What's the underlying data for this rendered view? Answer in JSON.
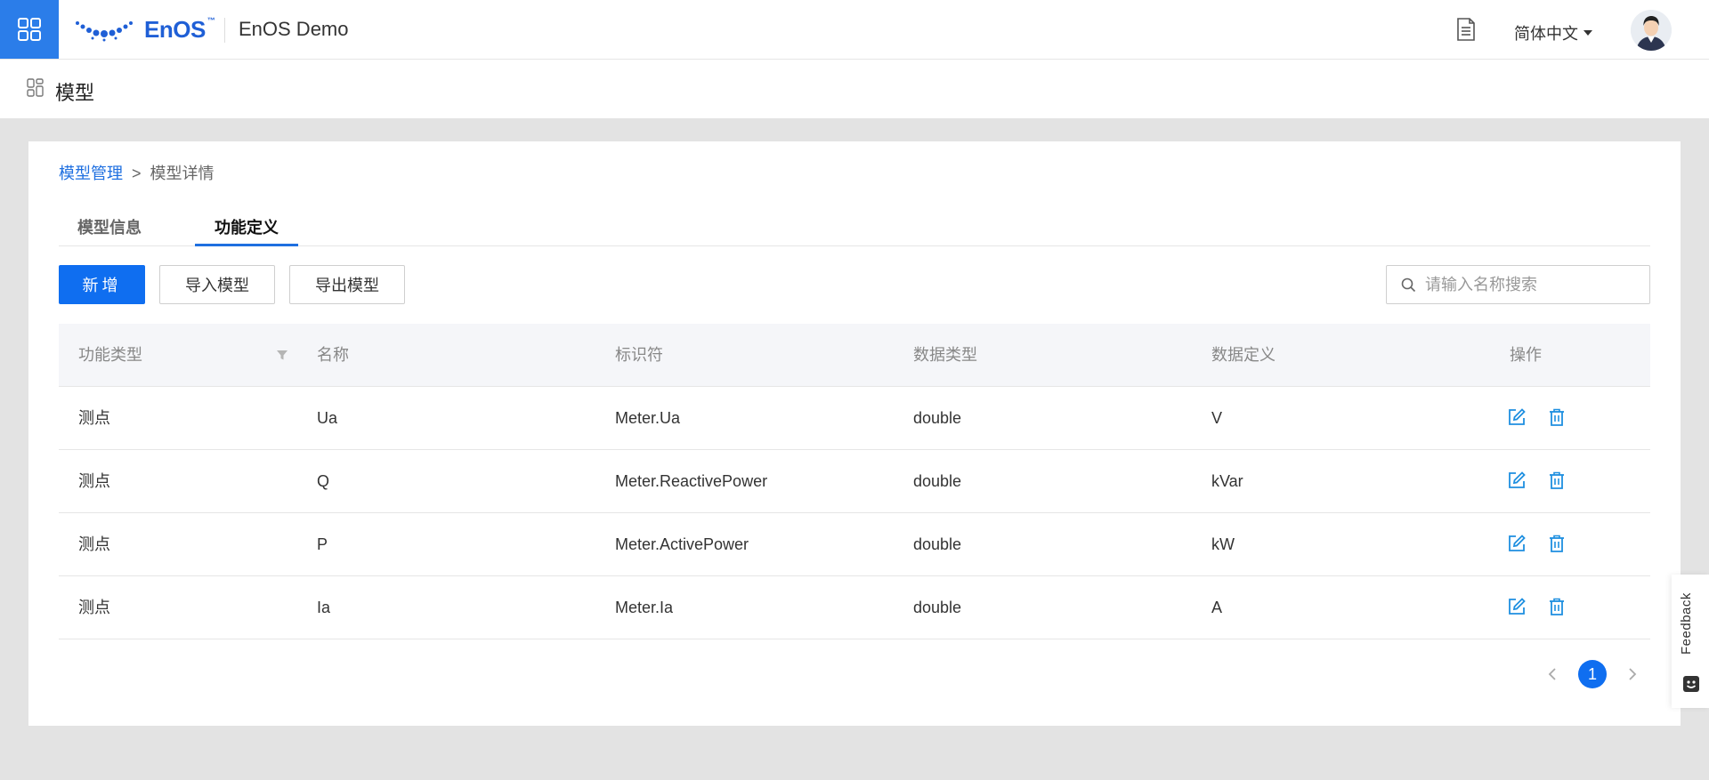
{
  "header": {
    "logo_text": "EnOS",
    "logo_tm": "™",
    "org_name": "EnOS Demo",
    "language": "简体中文"
  },
  "page": {
    "title": "模型"
  },
  "breadcrumb": {
    "parent": "模型管理",
    "separator": ">",
    "current": "模型详情"
  },
  "tabs": [
    {
      "label": "模型信息",
      "active": false
    },
    {
      "label": "功能定义",
      "active": true
    }
  ],
  "toolbar": {
    "add_label": "新增",
    "import_label": "导入模型",
    "export_label": "导出模型",
    "search_placeholder": "请输入名称搜索"
  },
  "table": {
    "columns": [
      "功能类型",
      "名称",
      "标识符",
      "数据类型",
      "数据定义",
      "操作"
    ],
    "rows": [
      {
        "type": "测点",
        "name": "Ua",
        "identifier": "Meter.Ua",
        "data_type": "double",
        "definition": "V"
      },
      {
        "type": "测点",
        "name": "Q",
        "identifier": "Meter.ReactivePower",
        "data_type": "double",
        "definition": "kVar"
      },
      {
        "type": "测点",
        "name": "P",
        "identifier": "Meter.ActivePower",
        "data_type": "double",
        "definition": "kW"
      },
      {
        "type": "测点",
        "name": "Ia",
        "identifier": "Meter.Ia",
        "data_type": "double",
        "definition": "A"
      }
    ]
  },
  "pagination": {
    "current_page": "1"
  },
  "feedback": {
    "label": "Feedback"
  },
  "colors": {
    "primary": "#0f6ef0",
    "header_accent": "#2b7de9",
    "background": "#e3e3e3"
  },
  "icons": [
    "apps-grid-icon",
    "enos-logo-icon",
    "document-icon",
    "user-avatar",
    "module-icon",
    "search-icon",
    "filter-icon",
    "edit-icon",
    "delete-icon",
    "chevron-left-icon",
    "chevron-right-icon",
    "feedback-face-icon"
  ]
}
